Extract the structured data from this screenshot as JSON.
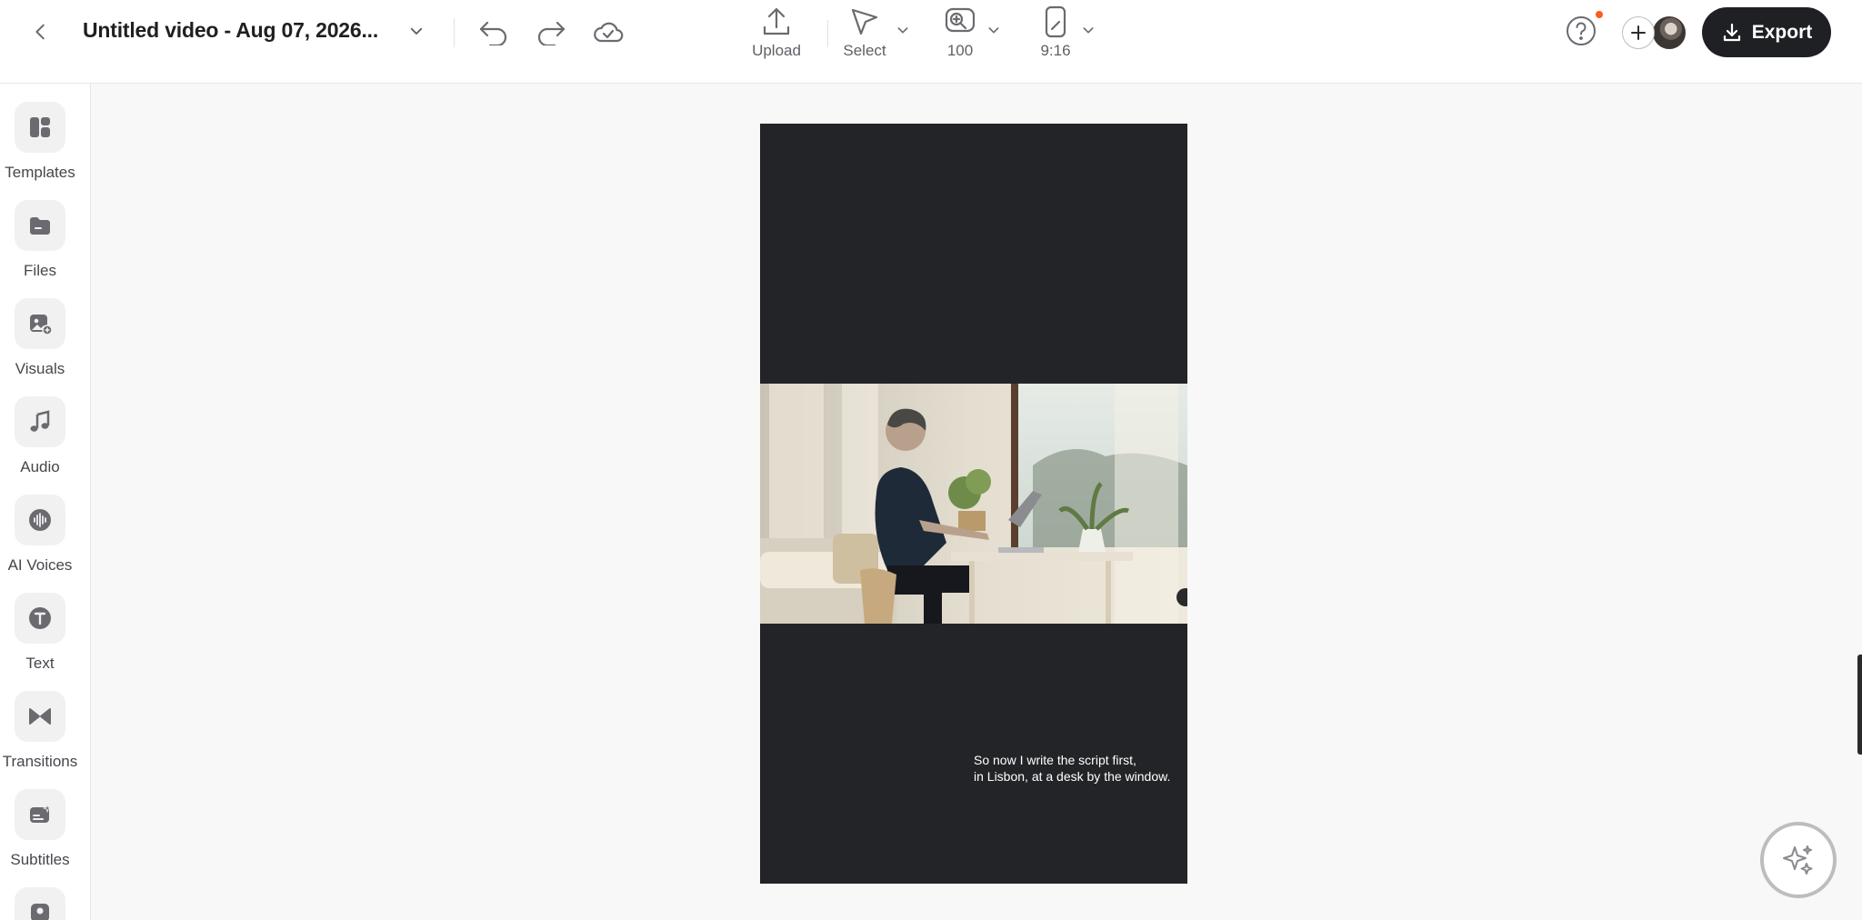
{
  "header": {
    "title": "Untitled video - Aug 07, 2026...",
    "tools": {
      "upload": "Upload",
      "select": "Select",
      "zoom": "100",
      "aspect": "9:16"
    },
    "export_label": "Export"
  },
  "sidebar": {
    "items": [
      {
        "label": "Templates",
        "icon": "templates-icon"
      },
      {
        "label": "Files",
        "icon": "folder-icon"
      },
      {
        "label": "Visuals",
        "icon": "image-add-icon"
      },
      {
        "label": "Audio",
        "icon": "music-note-icon"
      },
      {
        "label": "AI Voices",
        "icon": "waveform-icon"
      },
      {
        "label": "Text",
        "icon": "text-icon"
      },
      {
        "label": "Transitions",
        "icon": "bowtie-icon"
      },
      {
        "label": "Subtitles",
        "icon": "subtitles-icon"
      }
    ]
  },
  "canvas": {
    "subtitle_line_1": "So now I write the script first,",
    "subtitle_line_2": "in Lisbon, at a desk by the window."
  },
  "colors": {
    "accent": "#1f2023",
    "notification": "#ff5a1f",
    "video_background": "#232427"
  }
}
